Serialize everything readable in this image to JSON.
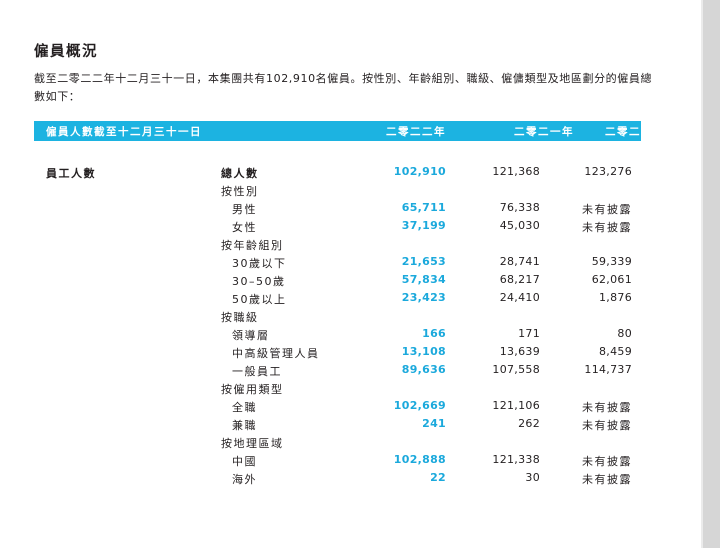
{
  "section": {
    "title": "僱員概況",
    "intro": "截至二零二二年十二月三十一日，本集團共有102,910名僱員。按性別、年齡組別、職級、僱傭類型及地區劃分的僱員總數如下："
  },
  "table": {
    "header": {
      "label": "僱員人數截至十二月三十一日",
      "year_2022": "二零二二年",
      "year_2021": "二零二一年",
      "year_2020": "二零二零年",
      "year_2020_mark": "^"
    },
    "section_label": "員工人數",
    "rows": [
      {
        "label": "總人數",
        "v2022": "102,910",
        "v2021": "121,368",
        "v2020": "123,276"
      },
      {
        "label": "按性別",
        "v2022": "",
        "v2021": "",
        "v2020": ""
      },
      {
        "label": "男性",
        "v2022": "65,711",
        "v2021": "76,338",
        "v2020": "未有披露"
      },
      {
        "label": "女性",
        "v2022": "37,199",
        "v2021": "45,030",
        "v2020": "未有披露"
      },
      {
        "label": "按年齡組別",
        "v2022": "",
        "v2021": "",
        "v2020": ""
      },
      {
        "label": "30歲以下",
        "v2022": "21,653",
        "v2021": "28,741",
        "v2020": "59,339"
      },
      {
        "label": "30–50歲",
        "v2022": "57,834",
        "v2021": "68,217",
        "v2020": "62,061"
      },
      {
        "label": "50歲以上",
        "v2022": "23,423",
        "v2021": "24,410",
        "v2020": "1,876"
      },
      {
        "label": "按職級",
        "v2022": "",
        "v2021": "",
        "v2020": ""
      },
      {
        "label": "領導層",
        "v2022": "166",
        "v2021": "171",
        "v2020": "80"
      },
      {
        "label": "中高級管理人員",
        "v2022": "13,108",
        "v2021": "13,639",
        "v2020": "8,459"
      },
      {
        "label": "一般員工",
        "v2022": "89,636",
        "v2021": "107,558",
        "v2020": "114,737"
      },
      {
        "label": "按僱用類型",
        "v2022": "",
        "v2021": "",
        "v2020": ""
      },
      {
        "label": "全職",
        "v2022": "102,669",
        "v2021": "121,106",
        "v2020": "未有披露"
      },
      {
        "label": "兼職",
        "v2022": "241",
        "v2021": "262",
        "v2020": "未有披露"
      },
      {
        "label": "按地理區域",
        "v2022": "",
        "v2021": "",
        "v2020": ""
      },
      {
        "label": "中國",
        "v2022": "102,888",
        "v2021": "121,338",
        "v2020": "未有披露"
      },
      {
        "label": "海外",
        "v2022": "22",
        "v2021": "30",
        "v2020": "未有披露"
      }
    ]
  },
  "colors": {
    "header_bg": "#1cb3e1",
    "accent_value": "#1ba9dc",
    "text": "#231f20"
  }
}
